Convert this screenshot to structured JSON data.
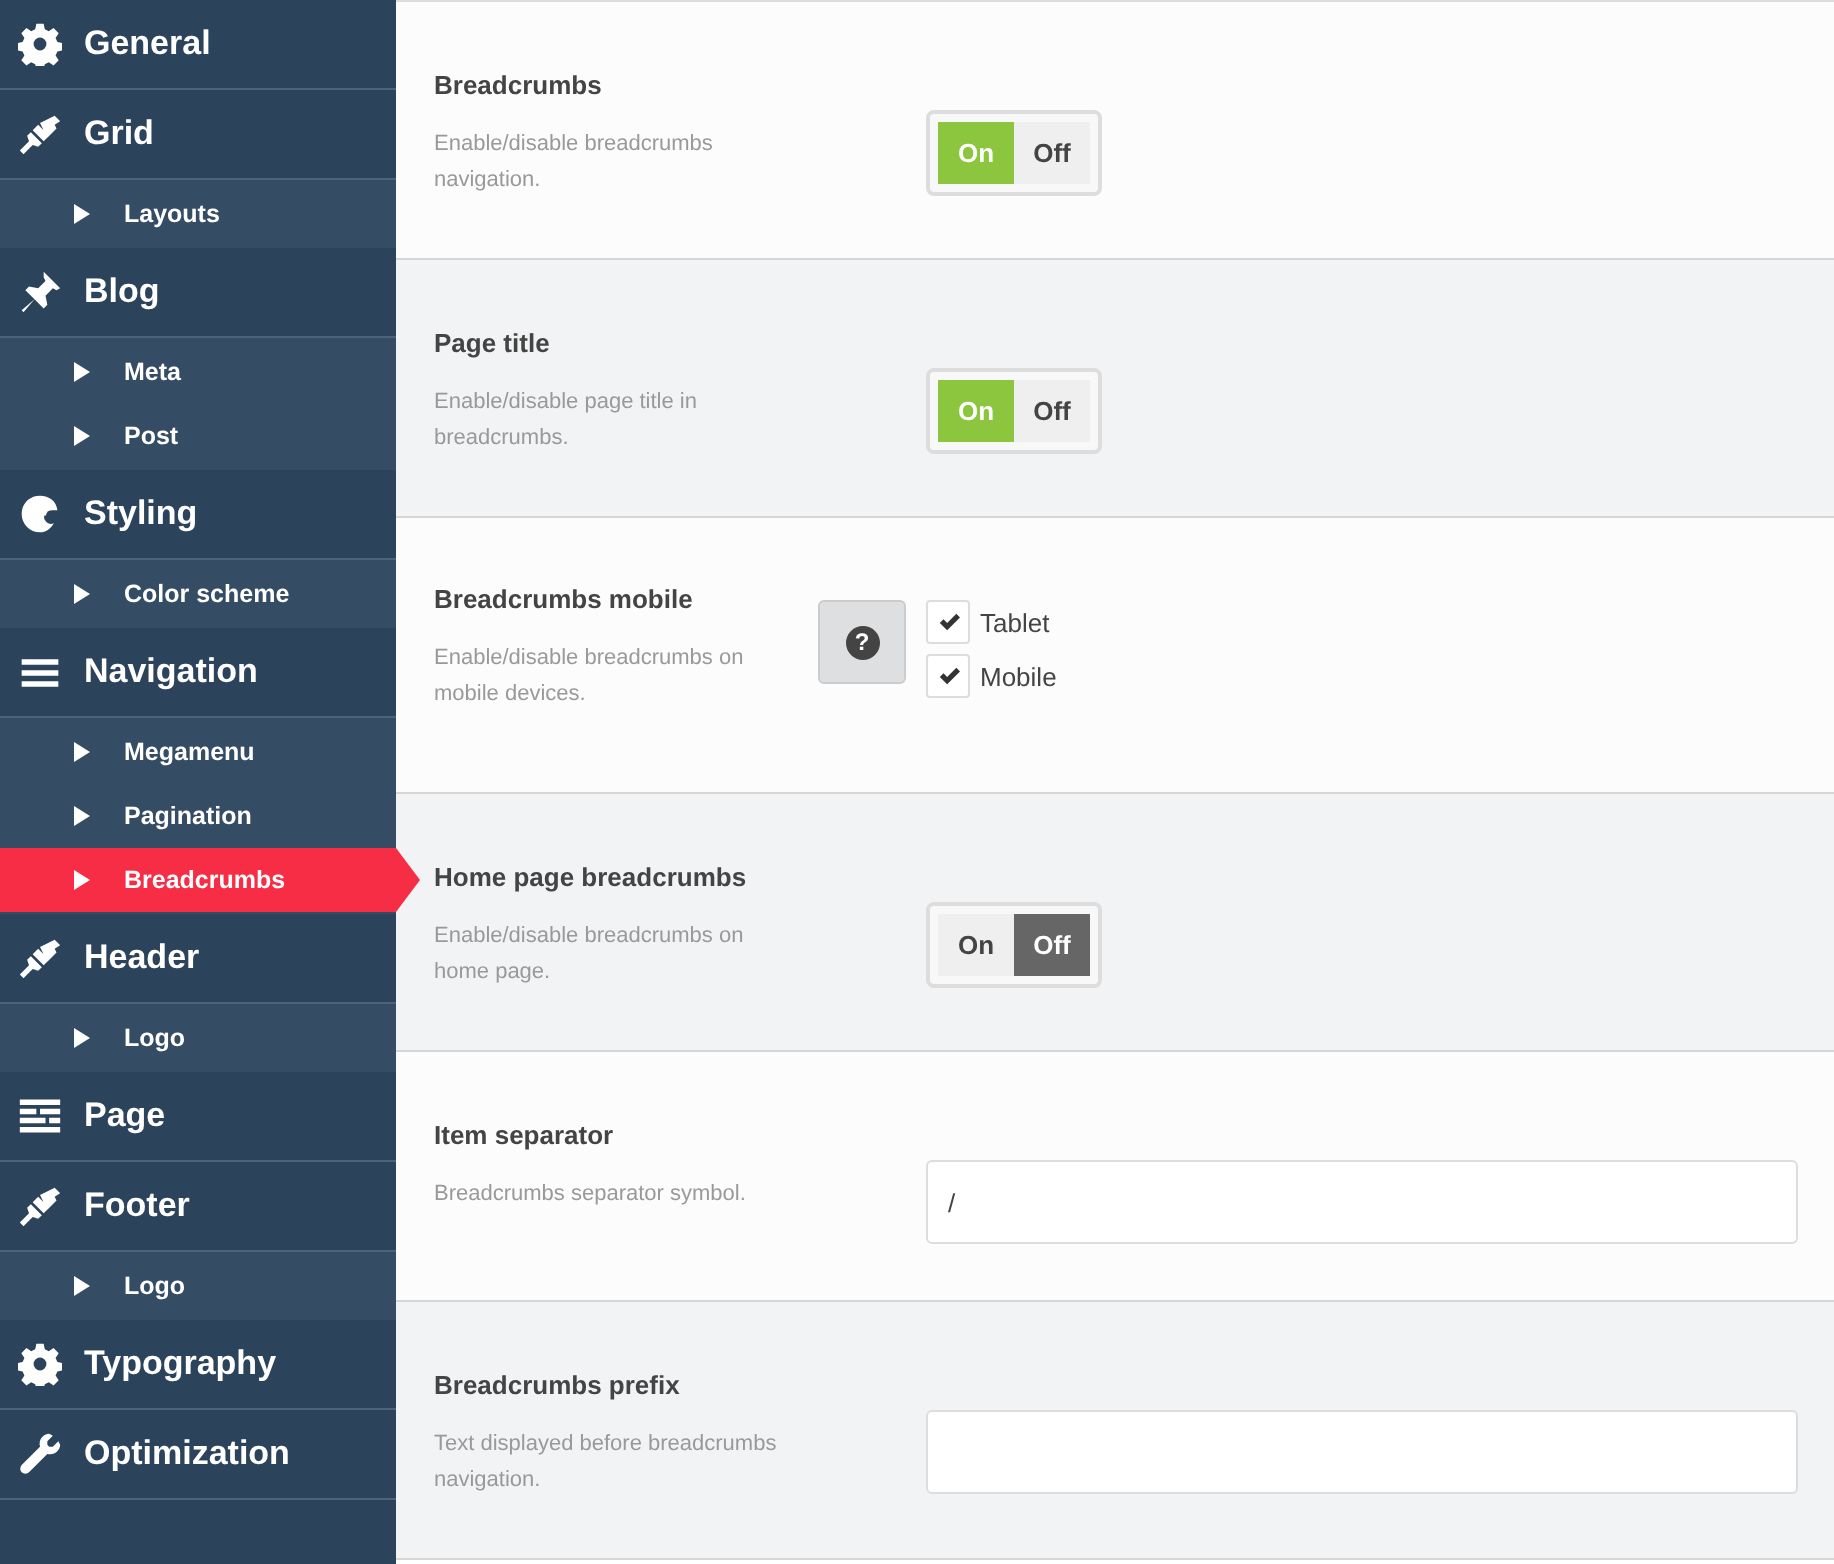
{
  "sidebar": {
    "items": [
      {
        "label": "General"
      },
      {
        "label": "Grid",
        "children": [
          {
            "label": "Layouts",
            "selected": false
          }
        ]
      },
      {
        "label": "Blog",
        "children": [
          {
            "label": "Meta",
            "selected": false
          },
          {
            "label": "Post",
            "selected": false
          }
        ]
      },
      {
        "label": "Styling",
        "children": [
          {
            "label": "Color scheme",
            "selected": false
          }
        ]
      },
      {
        "label": "Navigation",
        "children": [
          {
            "label": "Megamenu",
            "selected": false
          },
          {
            "label": "Pagination",
            "selected": false
          },
          {
            "label": "Breadcrumbs",
            "selected": true
          }
        ]
      },
      {
        "label": "Header",
        "children": [
          {
            "label": "Logo",
            "selected": false
          }
        ]
      },
      {
        "label": "Page"
      },
      {
        "label": "Footer",
        "children": [
          {
            "label": "Logo",
            "selected": false
          }
        ]
      },
      {
        "label": "Typography"
      },
      {
        "label": "Optimization"
      }
    ]
  },
  "settings": [
    {
      "kind": "toggle",
      "title": "Breadcrumbs",
      "description": "Enable/disable breadcrumbs navigation.",
      "on_label": "On",
      "off_label": "Off",
      "on": true
    },
    {
      "kind": "toggle",
      "title": "Page title",
      "description": "Enable/disable page title in breadcrumbs.",
      "on_label": "On",
      "off_label": "Off",
      "on": true
    },
    {
      "kind": "checkboxes",
      "title": "Breadcrumbs mobile",
      "description": "Enable/disable breadcrumbs on mobile devices.",
      "help": "?",
      "options": [
        {
          "label": "Tablet",
          "checked": true
        },
        {
          "label": "Mobile",
          "checked": true
        }
      ]
    },
    {
      "kind": "toggle",
      "title": "Home page breadcrumbs",
      "description": "Enable/disable breadcrumbs on home page.",
      "on_label": "On",
      "off_label": "Off",
      "on": false
    },
    {
      "kind": "text",
      "title": "Item separator",
      "description": "Breadcrumbs separator symbol.",
      "value": "/"
    },
    {
      "kind": "text",
      "title": "Breadcrumbs prefix",
      "description": "Text displayed before breadcrumbs navigation."
    }
  ]
}
